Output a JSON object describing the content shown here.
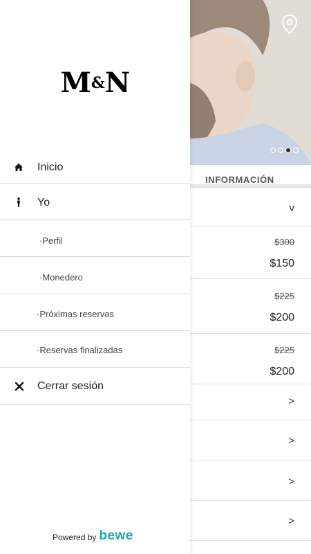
{
  "drawer": {
    "logo_left": "M",
    "logo_amp": "&",
    "logo_right": "N",
    "items": [
      {
        "label": "Inicio",
        "icon": "home-icon"
      },
      {
        "label": "Yo",
        "icon": "person-icon"
      },
      {
        "label": "·Perfil"
      },
      {
        "label": "·Monedero"
      },
      {
        "label": "·Próximas reservas"
      },
      {
        "label": "·Reservas finalizadas"
      },
      {
        "label": "Cerrar sesión",
        "icon": "close-icon"
      }
    ],
    "powered_by": "Powered by",
    "brand": "bewe"
  },
  "background": {
    "section_tab": "INFORMACIÓN",
    "chevron_down": "v",
    "chevron_right": ">",
    "prices": [
      {
        "old": "$300",
        "new": "$150"
      },
      {
        "old": "$225",
        "new": "$200"
      },
      {
        "old": "$225",
        "new": "$200"
      }
    ],
    "carousel": {
      "count": 4,
      "active_index": 2
    }
  },
  "colors": {
    "brand_accent": "#1fa6a6",
    "text": "#222222",
    "divider": "#dadada"
  }
}
